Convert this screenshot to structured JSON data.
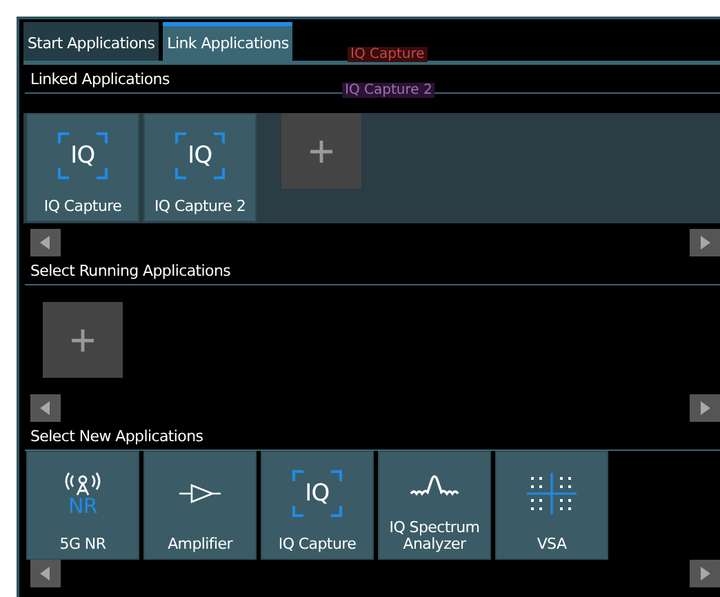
{
  "tabs": [
    {
      "label": "Start Applications",
      "selected": false
    },
    {
      "label": "Link Applications",
      "selected": true
    }
  ],
  "ghost_labels": [
    {
      "text": "IQ Capture"
    },
    {
      "text": "IQ Capture 2"
    }
  ],
  "sections": [
    {
      "title": "Linked Applications",
      "highlighted": true,
      "tiles": [
        {
          "kind": "iq",
          "icon_text": "IQ",
          "label": "IQ Capture"
        },
        {
          "kind": "iq",
          "icon_text": "IQ",
          "label": "IQ Capture 2"
        },
        {
          "kind": "add"
        }
      ]
    },
    {
      "title": "Select Running Applications",
      "highlighted": false,
      "tiles": [
        {
          "kind": "add"
        }
      ]
    },
    {
      "title": "Select New Applications",
      "highlighted": false,
      "tiles": [
        {
          "kind": "nr",
          "icon_text": "NR",
          "label": "5G NR"
        },
        {
          "kind": "amplifier",
          "label": "Amplifier"
        },
        {
          "kind": "iq",
          "icon_text": "IQ",
          "label": "IQ Capture"
        },
        {
          "kind": "spectrum",
          "label": "IQ Spectrum Analyzer"
        },
        {
          "kind": "vsa",
          "label": "VSA"
        }
      ]
    }
  ]
}
